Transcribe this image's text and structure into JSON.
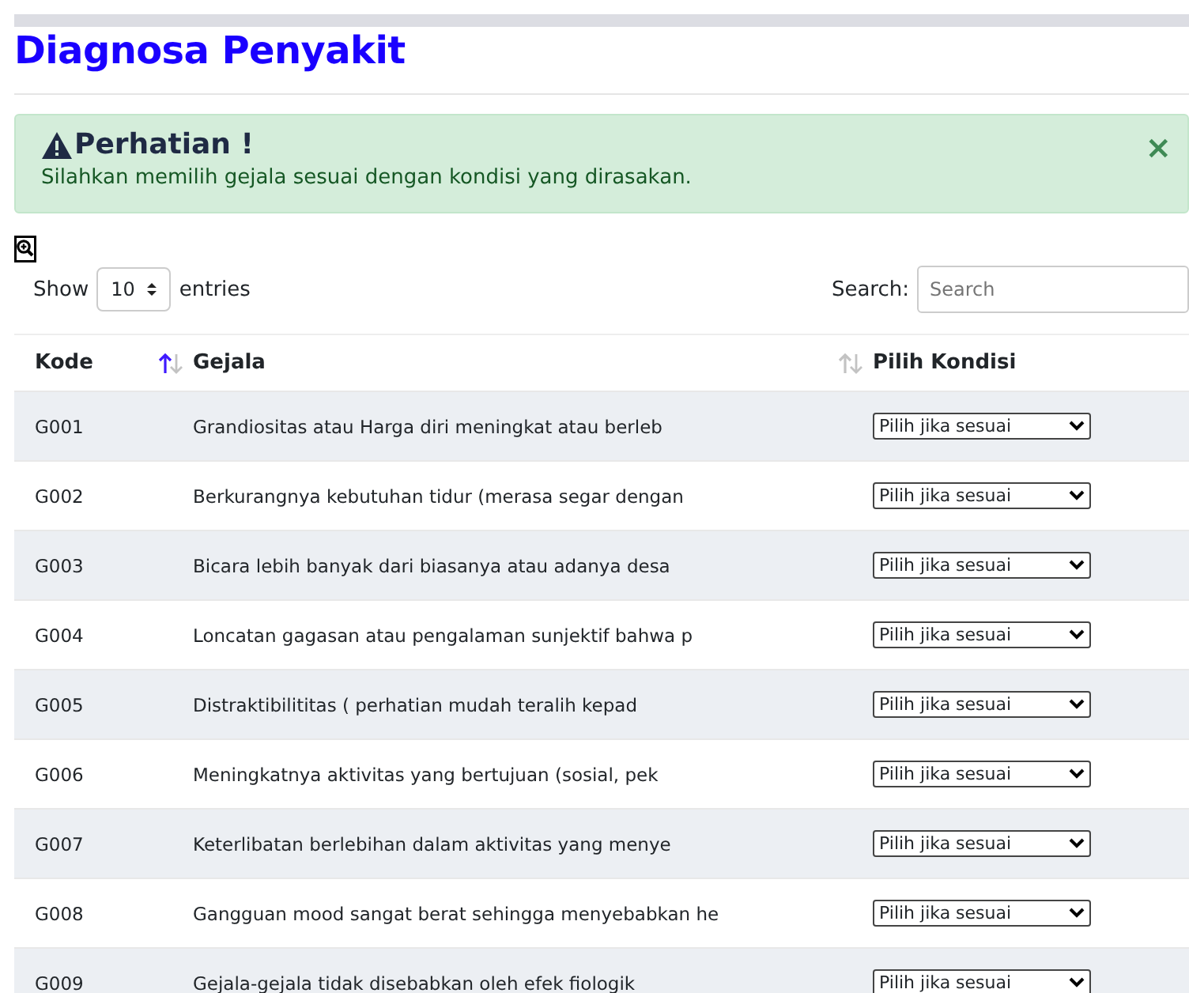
{
  "title": "Diagnosa Penyakit",
  "alert": {
    "heading": "Perhatian !",
    "message": "Silahkan memilih gejala sesuai dengan kondisi yang dirasakan.",
    "close": "×"
  },
  "length": {
    "show": "Show",
    "value": "10",
    "entries": "entries"
  },
  "search": {
    "label": "Search:",
    "placeholder": "Search"
  },
  "columns": [
    {
      "label": "Kode",
      "sorted": true
    },
    {
      "label": "Gejala",
      "sorted": false
    },
    {
      "label": "Pilih Kondisi"
    }
  ],
  "rows": [
    {
      "code": "G001",
      "symptom": "Grandiositas atau Harga diri meningkat atau berleb",
      "choice": "Pilih jika sesuai"
    },
    {
      "code": "G002",
      "symptom": "Berkurangnya kebutuhan tidur (merasa segar dengan",
      "choice": "Pilih jika sesuai"
    },
    {
      "code": "G003",
      "symptom": "Bicara lebih banyak dari biasanya atau adanya desa",
      "choice": "Pilih jika sesuai"
    },
    {
      "code": "G004",
      "symptom": "Loncatan gagasan atau pengalaman sunjektif bahwa p",
      "choice": "Pilih jika sesuai"
    },
    {
      "code": "G005",
      "symptom": "Distraktibilititas ( perhatian mudah teralih kepad",
      "choice": "Pilih jika sesuai"
    },
    {
      "code": "G006",
      "symptom": "Meningkatnya aktivitas yang bertujuan (sosial, pek",
      "choice": "Pilih jika sesuai"
    },
    {
      "code": "G007",
      "symptom": "Keterlibatan berlebihan dalam aktivitas yang menye",
      "choice": "Pilih jika sesuai"
    },
    {
      "code": "G008",
      "symptom": "Gangguan mood sangat berat sehingga menyebabkan he",
      "choice": "Pilih jika sesuai"
    },
    {
      "code": "G009",
      "symptom": "Gejala-gejala tidak disebabkan oleh efek fiologik",
      "choice": "Pilih jika sesuai"
    }
  ]
}
